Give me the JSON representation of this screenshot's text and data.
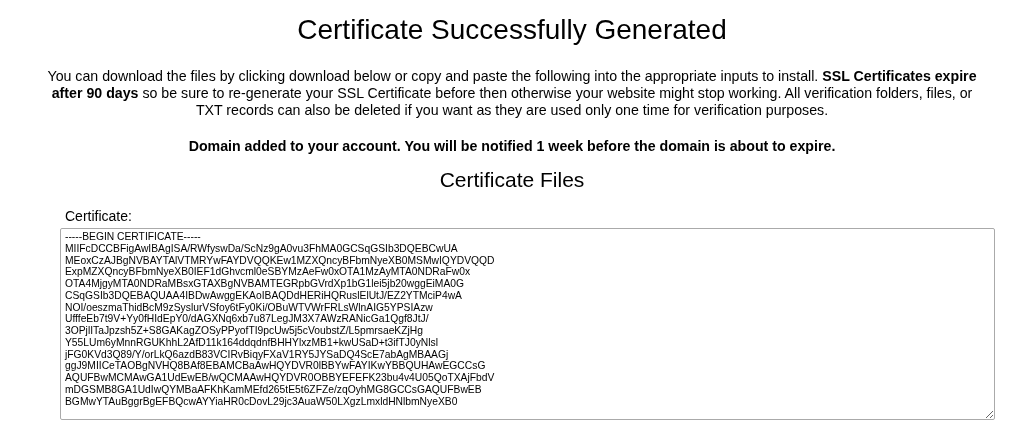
{
  "title": "Certificate Successfully Generated",
  "intro": "You can download the files by clicking download below or copy and paste the following into the appropriate inputs to install. **SSL Certificates expire after 90 days** so be sure to re-generate your SSL Certificate before then otherwise your website might stop working. All verification folders, files, or TXT records can also be deleted if you want as they are used only one time for verification purposes.",
  "notice": "Domain added to your account. You will be notified 1 week before the domain is about to expire.",
  "files_heading": "Certificate Files",
  "certificate": {
    "label": "Certificate:",
    "value": "-----BEGIN CERTIFICATE-----\nMIIFcDCCBFigAwIBAgISA/RWfyswDa/ScNz9gA0vu3FhMA0GCSqGSIb3DQEBCwUA\nMEoxCzAJBgNVBAYTAlVTMRYwFAYDVQQKEw1MZXQncyBFbmNyeXB0MSMwIQYDVQQD\nExpMZXQncyBFbmNyeXB0IEF1dGhvcml0eSBYMzAeFw0xOTA1MzAyMTA0NDRaFw0x\nOTA4MjgyMTA0NDRaMBsxGTAXBgNVBAMTEGRpbGVrdXp1bG1lei5jb20wggEiMA0G\nCSqGSIb3DQEBAQUAA4IBDwAwggEKAoIBAQDdHERiHQRuslElUtJ/EZ2YTMciP4wA\nNOI/oeszmaThidBcM9zSyslurVSfoy6tFy0Ki/OBuWTVWrFRLsWlnAIG5YPSIAzw\nUfffeEb7t9V+Yy0fHIdEpY0/dAGXNq6xb7u87LegJM3X7AWzRANicGa1Qgf8JtJ/\n3OPjlITaJpzsh5Z+S8GAKagZOSyPPyofTI9pcUw5j5cVoubstZ/L5pmrsaeKZjHg\nY55LUm6yMnnRGUKhhL2AfD11k164ddqdnfBHHYlxzMB1+kwUSaD+t3ifTJ0yNlsl\njFG0KVd3Q89/Y/orLkQ6azdB83VCIRvBiqyFXaV1RY5JYSaDQ4ScE7abAgMBAAGj\nggJ9MIICeTAOBgNVHQ8BAf8EBAMCBaAwHQYDVR0lBBYwFAYIKwYBBQUHAwEGCCsG\nAQUFBwMCMAwGA1UdEwEB/wQCMAAwHQYDVR0OBBYEFEFK23bu4v4U05QoTXAjFbdV\nmDGSMB8GA1UdIwQYMBaAFKhKamMEfd265tE5t6ZFZe/zqOyhMG8GCCsGAQUFBwEB\nBGMwYTAuBggrBgEFBQcwAYYiaHR0cDovL29jc3AuaW50LXgzLmxldHNlbmNyeXB0"
  }
}
